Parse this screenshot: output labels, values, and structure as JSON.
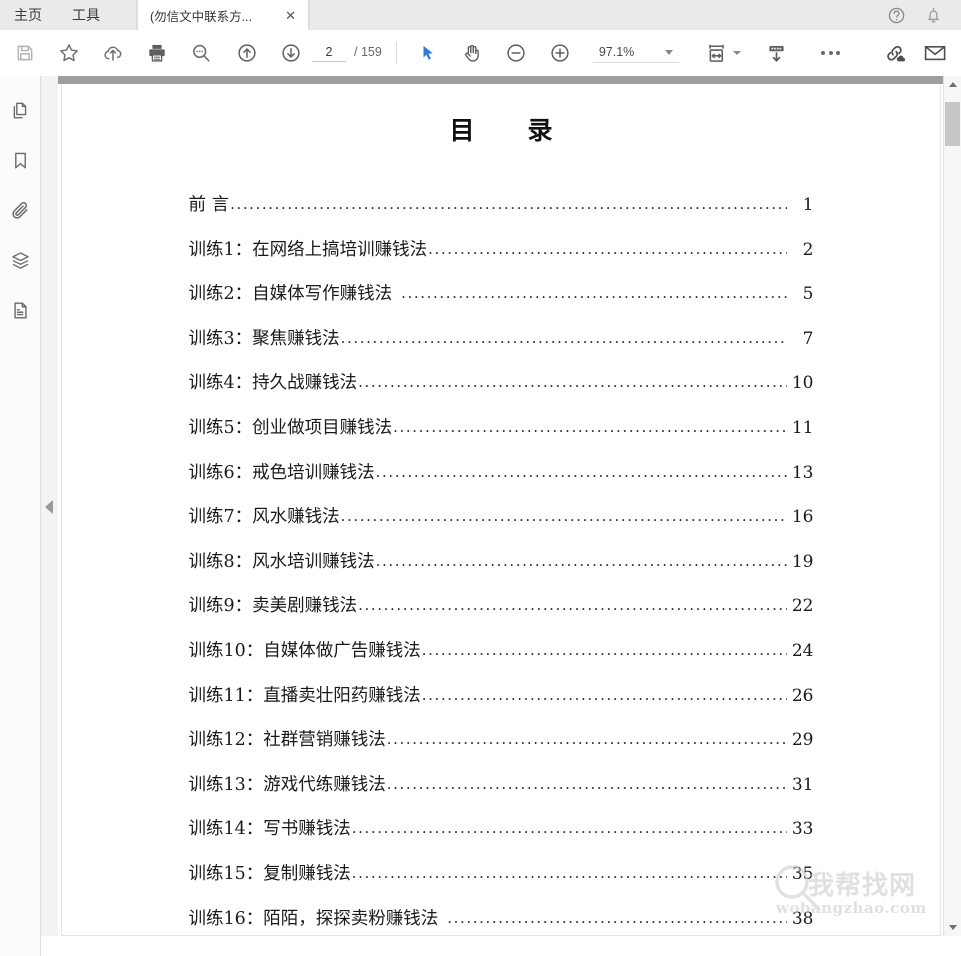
{
  "window": {
    "menu": [
      {
        "id": "home",
        "label": "主页"
      },
      {
        "id": "tools",
        "label": "工具"
      }
    ],
    "tab": {
      "title": "(勿信文中联系方...",
      "close_label": "✕"
    },
    "help_icon": "help-circle-icon",
    "bell_icon": "bell-icon"
  },
  "toolbar": {
    "save_icon": "save-icon",
    "star_icon": "star-icon",
    "upload_cloud_icon": "upload-cloud-icon",
    "print_icon": "print-icon",
    "search_icon": "search-icon",
    "prev_page_icon": "arrow-up-circle-icon",
    "next_page_icon": "arrow-down-circle-icon",
    "current_page": "2",
    "page_total": "/ 159",
    "select_tool_icon": "cursor-select-icon",
    "hand_tool_icon": "hand-pan-icon",
    "zoom_out_icon": "minus-circle-icon",
    "zoom_in_icon": "plus-circle-icon",
    "zoom_value": "97.1%",
    "fit_width_icon": "fit-page-width-icon",
    "scroll_mode_icon": "scroll-down-icon",
    "more_icon": "more-horizontal-icon",
    "link_cloud_icon": "link-cloud-icon",
    "mail_icon": "mail-envelope-icon"
  },
  "rail": {
    "items": [
      {
        "id": "thumbnails",
        "icon": "page-thumbnails-icon"
      },
      {
        "id": "bookmarks",
        "icon": "bookmark-icon"
      },
      {
        "id": "attachments",
        "icon": "paperclip-icon"
      },
      {
        "id": "layers",
        "icon": "layers-stack-icon"
      },
      {
        "id": "content",
        "icon": "document-text-icon"
      }
    ],
    "collapse_icon": "collapse-left-arrow-icon"
  },
  "document": {
    "title": "目　录",
    "toc": [
      {
        "label": "前  言",
        "page": "1",
        "tight": true
      },
      {
        "label": "训练1：在网络上搞培训赚钱法",
        "page": "2",
        "tight": true
      },
      {
        "label": "训练2：自媒体写作赚钱法",
        "page": "5",
        "tight": false
      },
      {
        "label": "训练3：聚焦赚钱法",
        "page": "7",
        "tight": true
      },
      {
        "label": "训练4：持久战赚钱法",
        "page": "10",
        "tight": true
      },
      {
        "label": "训练5：创业做项目赚钱法",
        "page": "11",
        "tight": true
      },
      {
        "label": "训练6：戒色培训赚钱法",
        "page": "13",
        "tight": true
      },
      {
        "label": "训练7：风水赚钱法",
        "page": "16",
        "tight": true
      },
      {
        "label": "训练8：风水培训赚钱法",
        "page": "19",
        "tight": true
      },
      {
        "label": "训练9：卖美剧赚钱法",
        "page": "22",
        "tight": true
      },
      {
        "label": "训练10：自媒体做广告赚钱法",
        "page": "24",
        "tight": true
      },
      {
        "label": "训练11：直播卖壮阳药赚钱法",
        "page": "26",
        "tight": true
      },
      {
        "label": "训练12：社群营销赚钱法",
        "page": "29",
        "tight": true
      },
      {
        "label": "训练13：游戏代练赚钱法",
        "page": "31",
        "tight": true
      },
      {
        "label": "训练14：写书赚钱法",
        "page": "33",
        "tight": true
      },
      {
        "label": "训练15：复制赚钱法",
        "page": "35",
        "tight": true
      },
      {
        "label": "训练16：陌陌，探探卖粉赚钱法",
        "page": "38",
        "tight": false
      }
    ]
  },
  "watermark": {
    "text": "我帮找网",
    "url": "wobangzhao.com",
    "icon": "magnifier-icon"
  },
  "scrollbar": {
    "up_icon": "chevron-up-icon",
    "down_icon": "chevron-down-icon"
  }
}
